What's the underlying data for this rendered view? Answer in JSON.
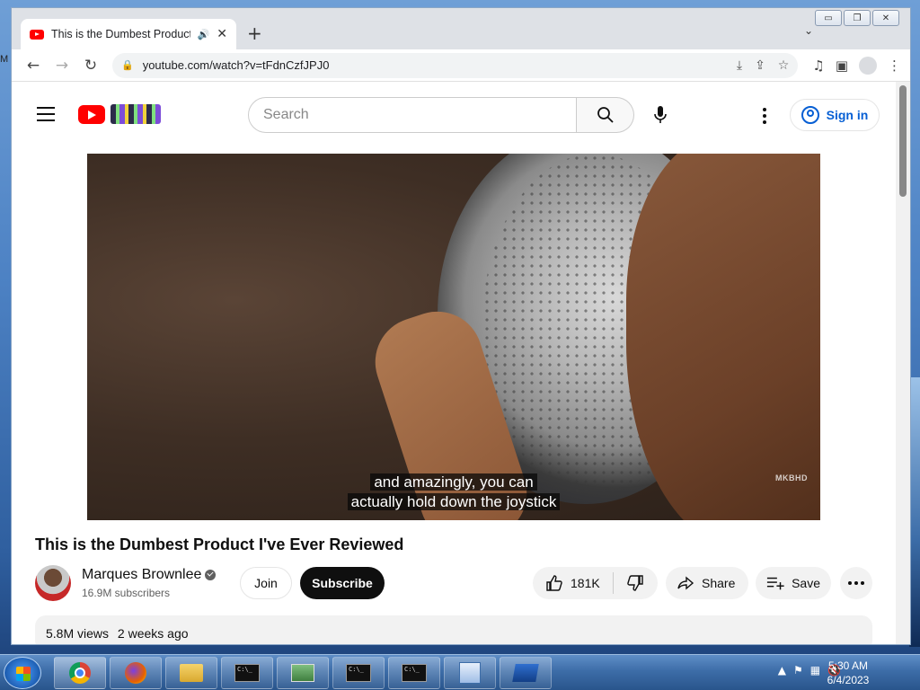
{
  "desktop": {
    "left_edge_text": "M"
  },
  "window": {
    "buttons": [
      "▭",
      "❐",
      "✕"
    ]
  },
  "browser": {
    "tab": {
      "title": "This is the Dumbest Product",
      "audio": "🔊",
      "close": "✕"
    },
    "newtab": "+",
    "tab_dropdown": "⌄",
    "url": "youtube.com/watch?v=tFdnCzfJPJ0"
  },
  "youtube": {
    "search": {
      "placeholder": "Search"
    },
    "signin": "Sign in",
    "caption_line1": "and amazingly, you can",
    "caption_line2": "actually hold down the joystick",
    "watermark": "MKBHD",
    "title": "This is the Dumbest Product I've Ever Reviewed",
    "channel": {
      "name": "Marques Brownlee",
      "subscribers": "16.9M subscribers"
    },
    "join": "Join",
    "subscribe": "Subscribe",
    "likes": "181K",
    "share": "Share",
    "save": "Save",
    "views": "5.8M views",
    "age": "2 weeks ago"
  },
  "taskbar": {
    "time": "5:30 AM",
    "date": "6/4/2023",
    "cmd_label": "C:\\_"
  },
  "colors": {
    "youtube_red": "#ff0000",
    "link_blue": "#065fd4",
    "subscribe_bg": "#0f0f0f"
  }
}
